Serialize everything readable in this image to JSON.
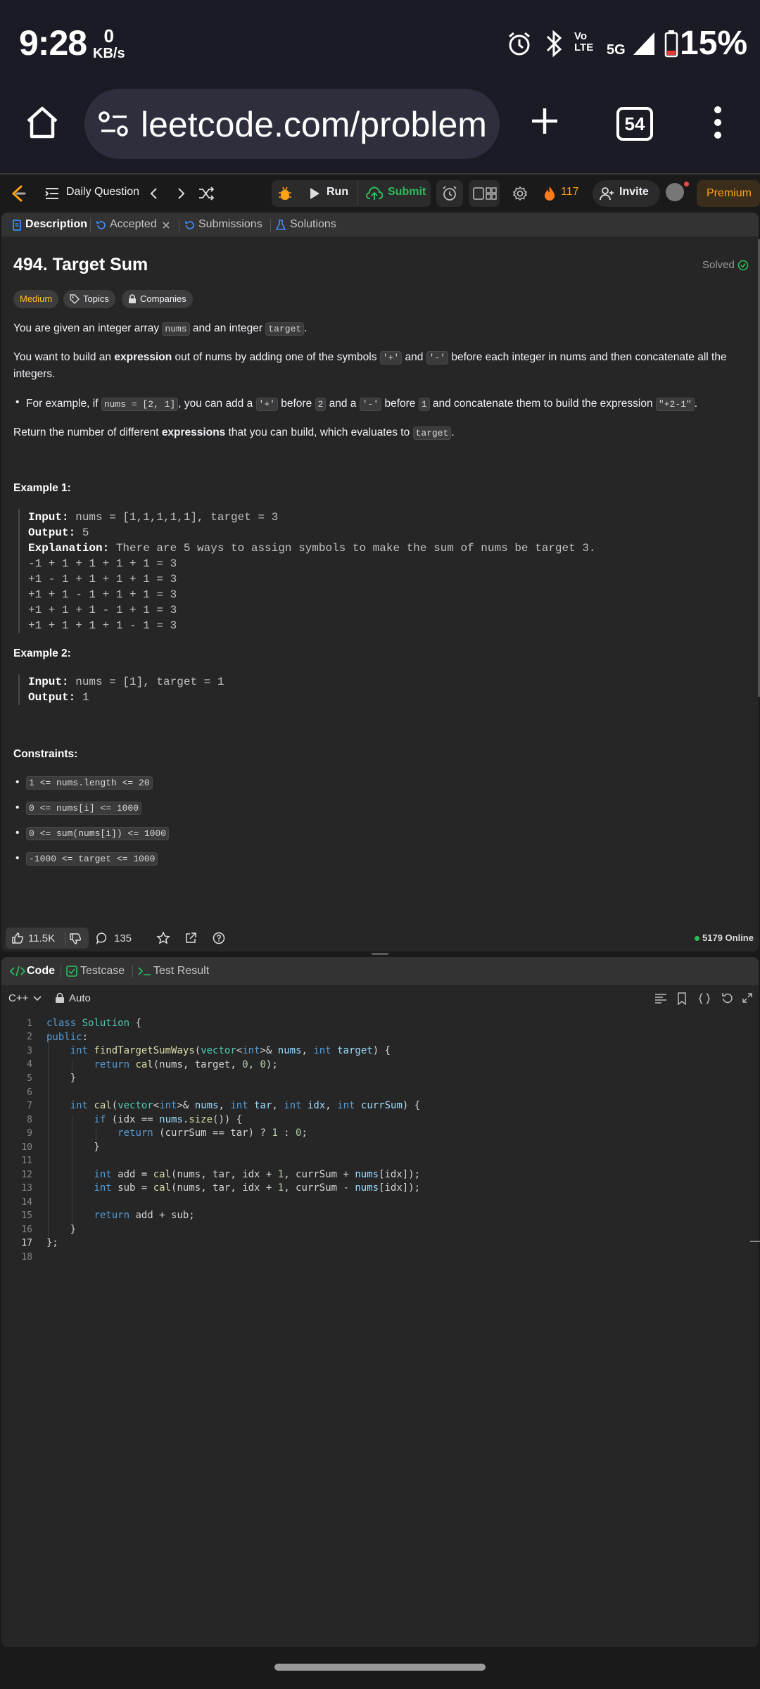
{
  "status_bar": {
    "time": "9:28",
    "net_speed_value": "0",
    "net_speed_unit": "KB/s",
    "network": "5G",
    "volte": "Vo LTE",
    "battery": "15%"
  },
  "browser": {
    "url": "leetcode.com/problem",
    "tab_count": "54"
  },
  "nav": {
    "daily_question": "Daily Question",
    "run": "Run",
    "submit": "Submit",
    "streak": "117",
    "invite": "Invite",
    "premium": "Premium"
  },
  "desc_tabs": {
    "description": "Description",
    "accepted": "Accepted",
    "submissions": "Submissions",
    "solutions": "Solutions"
  },
  "problem": {
    "title": "494. Target Sum",
    "solved": "Solved",
    "difficulty": "Medium",
    "topics": "Topics",
    "companies": "Companies",
    "p1_a": "You are given an integer array ",
    "p1_code1": "nums",
    "p1_b": " and an integer ",
    "p1_code2": "target",
    "p1_c": ".",
    "p2_a": "You want to build an ",
    "p2_bold": "expression",
    "p2_b": " out of nums by adding one of the symbols ",
    "p2_code1": "'+'",
    "p2_c": " and ",
    "p2_code2": "'-'",
    "p2_d": " before each integer in nums and then concatenate all the integers.",
    "b1_a": "For example, if ",
    "b1_code1": "nums = [2, 1]",
    "b1_b": ", you can add a ",
    "b1_code2": "'+'",
    "b1_c": " before ",
    "b1_code3": "2",
    "b1_d": " and a ",
    "b1_code4": "'-'",
    "b1_e": " before ",
    "b1_code5": "1",
    "b1_f": " and concatenate them to build the expression ",
    "b1_code6": "\"+2-1\"",
    "b1_g": ".",
    "p3_a": "Return the number of different ",
    "p3_bold": "expressions",
    "p3_b": " that you can build, which evaluates to ",
    "p3_code": "target",
    "p3_c": ".",
    "example1_title": "Example 1:",
    "example1": {
      "input_label": "Input:",
      "input": " nums = [1,1,1,1,1], target = 3",
      "output_label": "Output:",
      "output": " 5",
      "expl_label": "Explanation:",
      "expl": " There are 5 ways to assign symbols to make the sum of nums be target 3.",
      "lines": [
        "-1 + 1 + 1 + 1 + 1 = 3",
        "+1 - 1 + 1 + 1 + 1 = 3",
        "+1 + 1 - 1 + 1 + 1 = 3",
        "+1 + 1 + 1 - 1 + 1 = 3",
        "+1 + 1 + 1 + 1 - 1 = 3"
      ]
    },
    "example2_title": "Example 2:",
    "example2": {
      "input_label": "Input:",
      "input": " nums = [1], target = 1",
      "output_label": "Output:",
      "output": " 1"
    },
    "constraints_title": "Constraints:",
    "constraints": [
      "1 <= nums.length <= 20",
      "0 <= nums[i] <= 1000",
      "0 <= sum(nums[i]) <= 1000",
      "-1000 <= target <= 1000"
    ]
  },
  "footer": {
    "likes": "11.5K",
    "comments": "135",
    "online": "5179 Online"
  },
  "code_tabs": {
    "code": "Code",
    "testcase": "Testcase",
    "test_result": "Test Result"
  },
  "editor": {
    "language": "C++",
    "auto": "Auto",
    "line_numbers": [
      "1",
      "2",
      "3",
      "4",
      "5",
      "6",
      "7",
      "8",
      "9",
      "10",
      "11",
      "12",
      "13",
      "14",
      "15",
      "16",
      "17",
      "18"
    ]
  },
  "colors": {
    "accent_orange": "#ffa116",
    "submit_green": "#2cbb5d",
    "medium_yellow": "#ffc01e",
    "tab_blue": "#3f8cff"
  }
}
